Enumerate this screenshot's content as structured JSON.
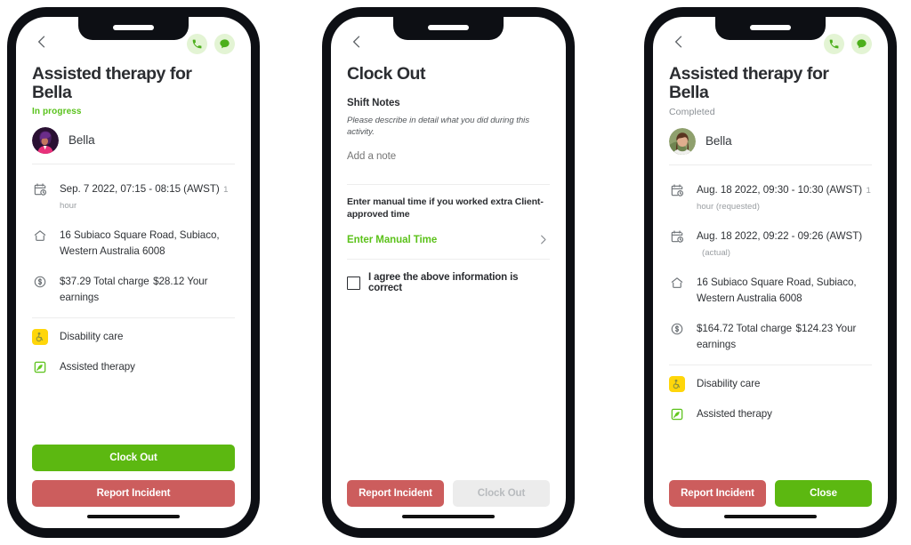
{
  "colors": {
    "green": "#5cb811",
    "link_green": "#5cc21b",
    "red": "#cc5d5d",
    "grey_disabled": "#ececec",
    "yellow_tag": "#ffd60a",
    "status_inprogress": "#59c21b",
    "status_completed": "#8a8f94"
  },
  "phones": [
    {
      "id": "shift-detail-in-progress",
      "topbar": {
        "back_icon": "chevron-left-icon",
        "call_icon": "phone-icon",
        "chat_icon": "chat-bubble-icon"
      },
      "title": "Assisted therapy for Bella",
      "status": "In progress",
      "person": {
        "name": "Bella",
        "avatar": "illustrated-avatar"
      },
      "rows": [
        {
          "icon": "calendar-clock-icon",
          "main": "Sep. 7 2022, 07:15 - 08:15 (AWST)",
          "sub": "1 hour"
        },
        {
          "icon": "home-icon",
          "main": "16 Subiaco Square Road, Subiaco, Western Australia 6008",
          "sub": ""
        },
        {
          "icon": "dollar-circle-icon",
          "main": "$37.29 Total charge",
          "sub": "$28.12 Your earnings"
        }
      ],
      "tags": [
        {
          "icon": "wheelchair-icon",
          "label": "Disability care",
          "style": "yellow"
        },
        {
          "icon": "therapy-leaf-icon",
          "label": "Assisted therapy",
          "style": "green"
        }
      ],
      "footer": {
        "layout": "stacked",
        "buttons": [
          {
            "label": "Clock Out",
            "style": "green"
          },
          {
            "label": "Report Incident",
            "style": "red"
          }
        ]
      }
    },
    {
      "id": "clock-out-form",
      "topbar": {
        "back_icon": "chevron-left-icon"
      },
      "title": "Clock Out",
      "shift_notes": {
        "label": "Shift Notes",
        "hint": "Please describe in detail what you did during this activity.",
        "note_value": "",
        "note_placeholder": "Add a note"
      },
      "manual_time": {
        "help": "Enter manual time if you worked extra Client-approved time",
        "link": "Enter Manual Time",
        "chevron": "chevron-right-icon"
      },
      "agreement": {
        "checked": false,
        "label": "I agree the above information is correct"
      },
      "footer": {
        "layout": "side-by-side",
        "buttons": [
          {
            "label": "Report Incident",
            "style": "red"
          },
          {
            "label": "Clock Out",
            "style": "grey"
          }
        ]
      }
    },
    {
      "id": "shift-detail-completed",
      "topbar": {
        "back_icon": "chevron-left-icon",
        "call_icon": "phone-icon",
        "chat_icon": "chat-bubble-icon"
      },
      "title": "Assisted therapy for Bella",
      "status": "Completed",
      "person": {
        "name": "Bella",
        "avatar": "photo-avatar"
      },
      "rows": [
        {
          "icon": "calendar-clock-icon",
          "main": "Aug. 18 2022, 09:30 - 10:30 (AWST)",
          "sub": "1 hour (requested)"
        },
        {
          "icon": "calendar-clock-icon",
          "main": "Aug. 18 2022, 09:22 - 09:26 (AWST)",
          "sub": "(actual)"
        },
        {
          "icon": "home-icon",
          "main": "16 Subiaco Square Road, Subiaco, Western Australia 6008",
          "sub": ""
        },
        {
          "icon": "dollar-circle-icon",
          "main": "$164.72 Total charge",
          "sub": "$124.23 Your earnings"
        }
      ],
      "tags": [
        {
          "icon": "wheelchair-icon",
          "label": "Disability care",
          "style": "yellow"
        },
        {
          "icon": "therapy-leaf-icon",
          "label": "Assisted therapy",
          "style": "green"
        }
      ],
      "footer": {
        "layout": "side-by-side",
        "buttons": [
          {
            "label": "Report Incident",
            "style": "red"
          },
          {
            "label": "Close",
            "style": "green"
          }
        ]
      }
    }
  ]
}
